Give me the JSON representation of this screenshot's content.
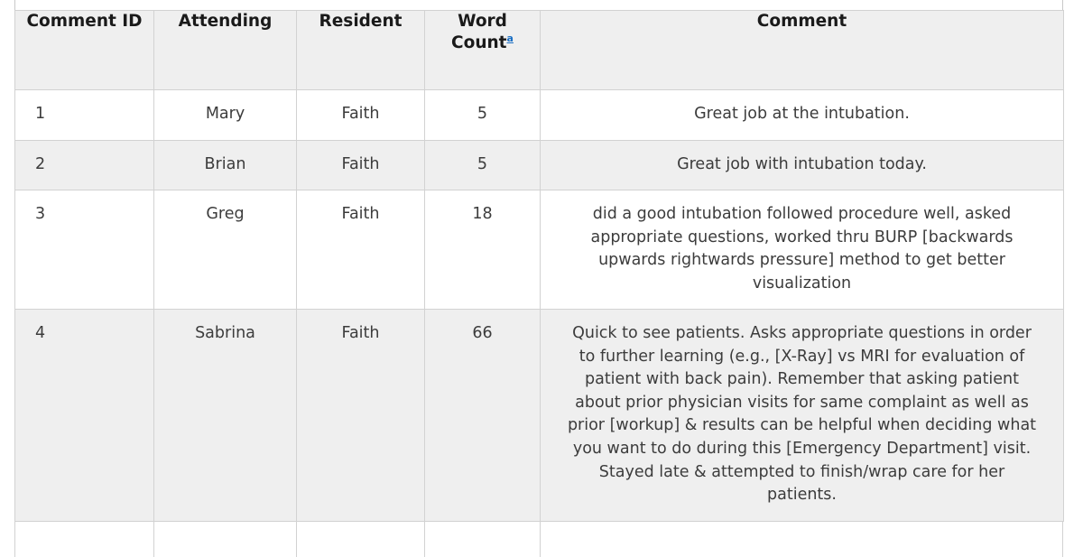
{
  "table": {
    "columns": [
      {
        "key": "comment_id",
        "label": "Comment ID"
      },
      {
        "key": "attending",
        "label": "Attending"
      },
      {
        "key": "resident",
        "label": "Resident"
      },
      {
        "key": "word_count",
        "label": "Word Count",
        "footnote": "a"
      },
      {
        "key": "comment",
        "label": "Comment"
      }
    ],
    "rows": [
      {
        "comment_id": "1",
        "attending": "Mary",
        "resident": "Faith",
        "word_count": "5",
        "comment": "Great job at the intubation."
      },
      {
        "comment_id": "2",
        "attending": "Brian",
        "resident": "Faith",
        "word_count": "5",
        "comment": "Great job with intubation today."
      },
      {
        "comment_id": "3",
        "attending": "Greg",
        "resident": "Faith",
        "word_count": "18",
        "comment": "did a good intubation followed procedure well, asked appropriate questions, worked thru BURP [backwards upwards rightwards pressure] method to get better visualization"
      },
      {
        "comment_id": "4",
        "attending": "Sabrina",
        "resident": "Faith",
        "word_count": "66",
        "comment": "Quick to see patients. Asks appropriate questions in order to further learning (e.g., [X-Ray] vs MRI for evaluation of patient with back pain). Remember that asking patient about prior physician visits for same complaint as well as prior [workup] & results can be helpful when deciding what you want to do during this [Emergency Department] visit. Stayed late & attempted to finish/wrap care for her patients."
      }
    ]
  },
  "colors": {
    "header_background": "#efefef",
    "stripe_background": "#efefef",
    "row_background": "#ffffff",
    "border": "#d2d2d2",
    "header_border": "#b4b4b4",
    "text": "#3c3c3c",
    "header_text": "#1a1a1a",
    "link": "#1a6fc4"
  }
}
